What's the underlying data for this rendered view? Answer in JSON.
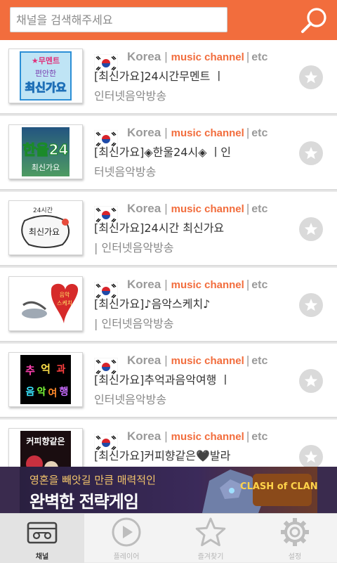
{
  "search": {
    "placeholder": "채널을 검색해주세요",
    "icon": "search-icon"
  },
  "channels": [
    {
      "country": "Korea",
      "genre": "music channel",
      "tag": "etc",
      "title": "[최신가요]24시간무멘트 ㅣ",
      "subtitle": "인터넷음악방송",
      "thumb_text": "★무멘트 편안한 최신가요"
    },
    {
      "country": "Korea",
      "genre": "music channel",
      "tag": "etc",
      "title": "[최신가요]◈한울24시◈ ㅣ인",
      "subtitle": "터넷음악방송",
      "thumb_text": "한울24 최신가요"
    },
    {
      "country": "Korea",
      "genre": "music channel",
      "tag": "etc",
      "title": "[최신가요]24시간 최신가요",
      "subtitle": "| 인터넷음악방송",
      "thumb_text": "24시간 최신가요"
    },
    {
      "country": "Korea",
      "genre": "music channel",
      "tag": "etc",
      "title": "[최신가요]♪음악스케치♪",
      "subtitle": "| 인터넷음악방송",
      "thumb_text": "음악 스케치"
    },
    {
      "country": "Korea",
      "genre": "music channel",
      "tag": "etc",
      "title": "[최신가요]추억과음악여행 ㅣ",
      "subtitle": "인터넷음악방송",
      "thumb_text": "추억과 음악여행"
    },
    {
      "country": "Korea",
      "genre": "music channel",
      "tag": "etc",
      "title": "[최신가요]커피향같은🖤발라",
      "subtitle": "",
      "thumb_text": "커피향같은"
    }
  ],
  "ad": {
    "line1": "영혼을 빼앗길 만큼 매력적인",
    "line2": "완벽한 전략게임",
    "brand": "CLASH of CLANS"
  },
  "tabs": [
    {
      "label": "채널",
      "icon": "radio-icon",
      "active": true
    },
    {
      "label": "플레이어",
      "icon": "play-icon",
      "active": false
    },
    {
      "label": "즐겨찾기",
      "icon": "star-icon",
      "active": false
    },
    {
      "label": "설정",
      "icon": "gear-icon",
      "active": false
    }
  ],
  "colors": {
    "accent": "#f26d3d",
    "muted": "#9a9a9a"
  }
}
